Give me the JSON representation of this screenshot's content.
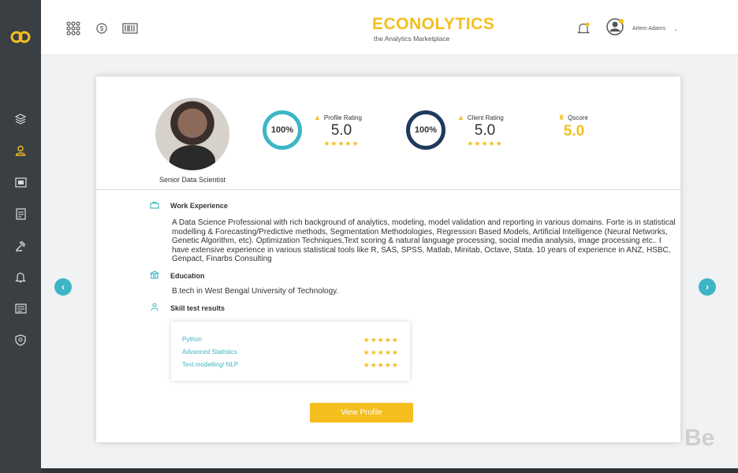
{
  "header": {
    "brand_name": "ECONOLYTICS",
    "brand_tagline": "the Analytics Marketplace",
    "user_name": "Artem Adams"
  },
  "profile": {
    "title": "Senior Data Scientist",
    "profile_rating": {
      "label": "Profile Rating",
      "percent": "100%",
      "value": "5.0",
      "stars": "★★★★★"
    },
    "client_rating": {
      "label": "Client Rating",
      "percent": "100%",
      "value": "5.0",
      "stars": "★★★★★"
    },
    "qscore": {
      "label": "Qscore",
      "value": "5.0"
    }
  },
  "work": {
    "heading": "Work Experience",
    "text": "A Data Science Professional with rich background of analytics, modeling, model validation and reporting in various domains. Forte is in statistical modelling & Forecasting/Predictive methods, Segmentation Methodologies, Regression Based Models, Artificial Intelligence (Neural Networks, Genetic Algorithm, etc). Optimization Techniques,Text scoring & natural language processing, social media analysis, image processing etc.. I have extensive experience in various statistical tools like R, SAS, SPSS, Matlab, Minitab, Octave, Stata. 10 years of experience in ANZ, HSBC, Genpact, Finarbs Consulting"
  },
  "education": {
    "heading": "Education",
    "text": "B.tech in West Bengal University of Technology."
  },
  "skills": {
    "heading": "Skill test results",
    "items": [
      {
        "name": "Python",
        "stars": "★★★★★"
      },
      {
        "name": "Advanced Statistics",
        "stars": "★★★★★"
      },
      {
        "name": "Text modelling/ NLP",
        "stars": "★★★★★"
      }
    ]
  },
  "actions": {
    "view_profile": "View Profile"
  },
  "watermark": "Be",
  "colors": {
    "accent": "#f3be1e",
    "teal": "#3cb6c4",
    "navy": "#1f3a5c",
    "sidebar": "#3a3f43"
  }
}
